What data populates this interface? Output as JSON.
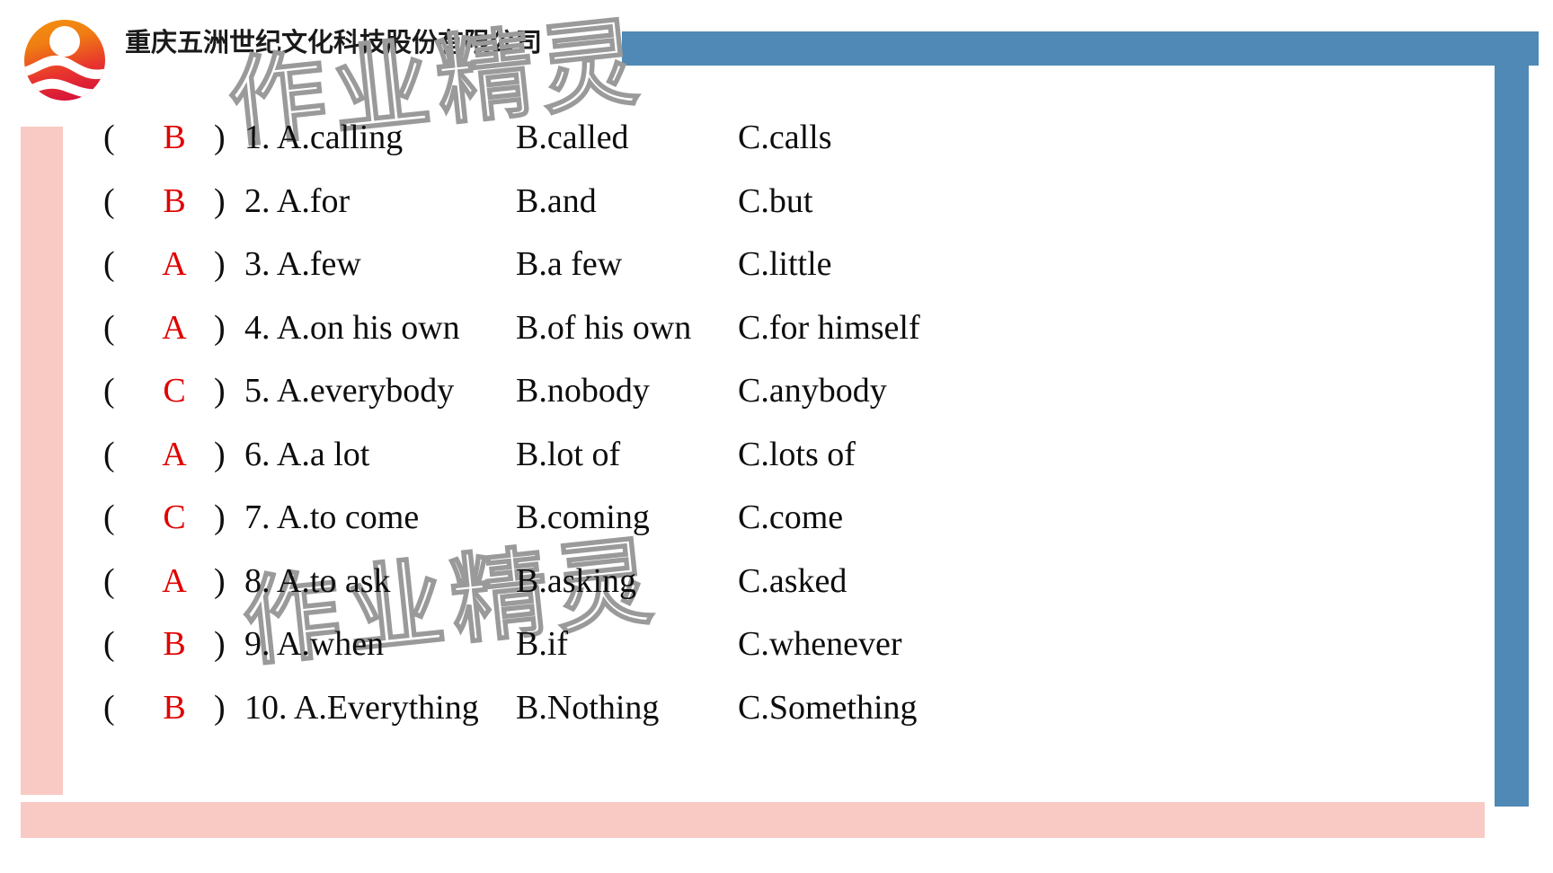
{
  "header": {
    "company_name": "重庆五洲世纪文化科技股份有限公司",
    "logo_icon": "sun-wave-circle-logo-icon"
  },
  "watermark": {
    "text": "作业精灵"
  },
  "colors": {
    "accent_blue": "#5089b5",
    "accent_pink": "#f9cac4",
    "answer_red": "#e00000",
    "text_black": "#0d0d0d",
    "watermark_stroke": "#9a9a9a",
    "logo_orange": "#f3921d",
    "logo_red": "#e2232b"
  },
  "exercise": {
    "paren_open": "(",
    "paren_close": ")",
    "rows": [
      {
        "number": "1.",
        "answer": "B",
        "a": "A.calling",
        "b": "B.called",
        "c": "C.calls"
      },
      {
        "number": "2.",
        "answer": "B",
        "a": "A.for",
        "b": "B.and",
        "c": "C.but"
      },
      {
        "number": "3.",
        "answer": "A",
        "a": "A.few",
        "b": "B.a few",
        "c": "C.little"
      },
      {
        "number": "4.",
        "answer": "A",
        "a": "A.on his own",
        "b": "B.of his own",
        "c": "C.for himself"
      },
      {
        "number": "5.",
        "answer": "C",
        "a": "A.everybody",
        "b": "B.nobody",
        "c": "C.anybody"
      },
      {
        "number": "6.",
        "answer": "A",
        "a": "A.a lot",
        "b": "B.lot of",
        "c": "C.lots of"
      },
      {
        "number": "7.",
        "answer": "C",
        "a": "A.to come",
        "b": "B.coming",
        "c": "C.come"
      },
      {
        "number": "8.",
        "answer": "A",
        "a": "A.to ask",
        "b": "B.asking",
        "c": "C.asked"
      },
      {
        "number": "9.",
        "answer": "B",
        "a": "A.when",
        "b": "B.if",
        "c": "C.whenever"
      },
      {
        "number": "10.",
        "answer": "B",
        "a": "A.Everything",
        "b": "B.Nothing",
        "c": "C.Something"
      }
    ]
  }
}
